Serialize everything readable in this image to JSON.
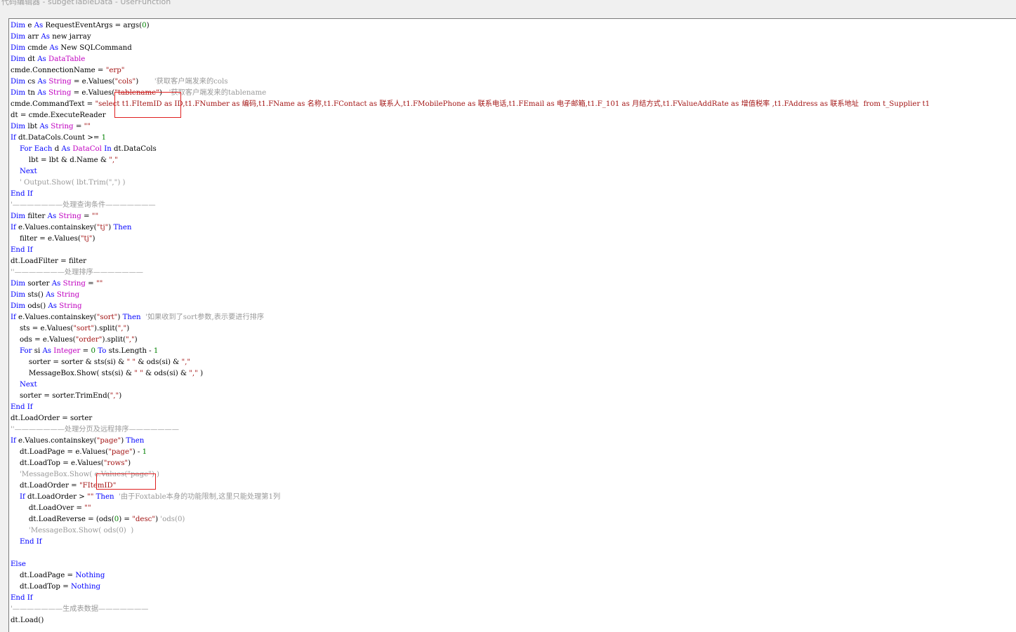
{
  "window": {
    "title": "代码编辑器 - subgetTableData - UserFunction"
  },
  "code_lines": [
    [
      [
        "kw",
        "Dim"
      ],
      [
        "t",
        " e "
      ],
      [
        "kw",
        "As"
      ],
      [
        "t",
        " RequestEventArgs = args("
      ],
      [
        "nm",
        "0"
      ],
      [
        "t",
        ")"
      ]
    ],
    [
      [
        "kw",
        "Dim"
      ],
      [
        "t",
        " arr "
      ],
      [
        "kw",
        "As"
      ],
      [
        "t",
        " new jarray"
      ]
    ],
    [
      [
        "kw",
        "Dim"
      ],
      [
        "t",
        " cmde "
      ],
      [
        "kw",
        "As"
      ],
      [
        "t",
        " New SQLCommand"
      ]
    ],
    [
      [
        "kw",
        "Dim"
      ],
      [
        "t",
        " dt "
      ],
      [
        "kw",
        "As"
      ],
      [
        "t",
        " "
      ],
      [
        "ty",
        "DataTable"
      ]
    ],
    [
      [
        "t",
        "cmde.ConnectionName = "
      ],
      [
        "st",
        "\"erp\""
      ]
    ],
    [
      [
        "kw",
        "Dim"
      ],
      [
        "t",
        " cs "
      ],
      [
        "kw",
        "As"
      ],
      [
        "t",
        " "
      ],
      [
        "ty",
        "String"
      ],
      [
        "t",
        " = e.Values("
      ],
      [
        "st",
        "\"cols\""
      ],
      [
        "t",
        ")       "
      ],
      [
        "cm",
        "'获取客户端发来的cols"
      ]
    ],
    [
      [
        "kw",
        "Dim"
      ],
      [
        "t",
        " tn "
      ],
      [
        "kw",
        "As"
      ],
      [
        "t",
        " "
      ],
      [
        "ty",
        "String"
      ],
      [
        "t",
        " = e.Values("
      ],
      [
        "st",
        "\"tablename\""
      ],
      [
        "t",
        ")   "
      ],
      [
        "cm",
        "'获取客户端发来的tablename"
      ]
    ],
    [
      [
        "t",
        "cmde.CommandText = "
      ],
      [
        "st",
        "\"select t1.FItemID as ID,t1.FNumber as 编码,t1.FName as 名称,t1.FContact as 联系人,t1.FMobilePhone as 联系电话,t1.FEmail as 电子邮箱,t1.F_101 as 月结方式,t1.FValueAddRate as 增值税率 ,t1.FAddress as 联系地址  from t_Supplier t1"
      ]
    ],
    [
      [
        "t",
        "dt = cmde.ExecuteReader"
      ]
    ],
    [
      [
        "kw",
        "Dim"
      ],
      [
        "t",
        " lbt "
      ],
      [
        "kw",
        "As"
      ],
      [
        "t",
        " "
      ],
      [
        "ty",
        "String"
      ],
      [
        "t",
        " = "
      ],
      [
        "st",
        "\"\""
      ]
    ],
    [
      [
        "kw",
        "If"
      ],
      [
        "t",
        " dt.DataCols.Count >= "
      ],
      [
        "nm",
        "1"
      ]
    ],
    [
      [
        "t",
        "    "
      ],
      [
        "kw",
        "For Each"
      ],
      [
        "t",
        " d "
      ],
      [
        "kw",
        "As"
      ],
      [
        "t",
        " "
      ],
      [
        "ty",
        "DataCol"
      ],
      [
        "t",
        " "
      ],
      [
        "kw",
        "In"
      ],
      [
        "t",
        " dt.DataCols"
      ]
    ],
    [
      [
        "t",
        "        lbt = lbt & d.Name & "
      ],
      [
        "st",
        "\",\""
      ]
    ],
    [
      [
        "t",
        "    "
      ],
      [
        "kw",
        "Next"
      ]
    ],
    [
      [
        "t",
        "    "
      ],
      [
        "cm",
        "' Output.Show( lbt.Trim(\",\") )"
      ]
    ],
    [
      [
        "kw",
        "End If"
      ]
    ],
    [
      [
        "cm",
        "'———————处理查询条件———————"
      ]
    ],
    [
      [
        "kw",
        "Dim"
      ],
      [
        "t",
        " filter "
      ],
      [
        "kw",
        "As"
      ],
      [
        "t",
        " "
      ],
      [
        "ty",
        "String"
      ],
      [
        "t",
        " = "
      ],
      [
        "st",
        "\"\""
      ]
    ],
    [
      [
        "kw",
        "If"
      ],
      [
        "t",
        " e.Values.containskey("
      ],
      [
        "st",
        "\"tj\""
      ],
      [
        "t",
        ") "
      ],
      [
        "kw",
        "Then"
      ]
    ],
    [
      [
        "t",
        "    filter = e.Values("
      ],
      [
        "st",
        "\"tj\""
      ],
      [
        "t",
        ")"
      ]
    ],
    [
      [
        "kw",
        "End If"
      ]
    ],
    [
      [
        "t",
        "dt.LoadFilter = filter"
      ]
    ],
    [
      [
        "cm",
        "''———————处理排序———————"
      ]
    ],
    [
      [
        "kw",
        "Dim"
      ],
      [
        "t",
        " sorter "
      ],
      [
        "kw",
        "As"
      ],
      [
        "t",
        " "
      ],
      [
        "ty",
        "String"
      ],
      [
        "t",
        " = "
      ],
      [
        "st",
        "\"\""
      ]
    ],
    [
      [
        "kw",
        "Dim"
      ],
      [
        "t",
        " sts() "
      ],
      [
        "kw",
        "As"
      ],
      [
        "t",
        " "
      ],
      [
        "ty",
        "String"
      ]
    ],
    [
      [
        "kw",
        "Dim"
      ],
      [
        "t",
        " ods() "
      ],
      [
        "kw",
        "As"
      ],
      [
        "t",
        " "
      ],
      [
        "ty",
        "String"
      ]
    ],
    [
      [
        "kw",
        "If"
      ],
      [
        "t",
        " e.Values.containskey("
      ],
      [
        "st",
        "\"sort\""
      ],
      [
        "t",
        ") "
      ],
      [
        "kw",
        "Then"
      ],
      [
        "t",
        "  "
      ],
      [
        "cm",
        "'如果收到了sort参数,表示要进行排序"
      ]
    ],
    [
      [
        "t",
        "    sts = e.Values("
      ],
      [
        "st",
        "\"sort\""
      ],
      [
        "t",
        ").split("
      ],
      [
        "st",
        "\",\""
      ],
      [
        "t",
        ")"
      ]
    ],
    [
      [
        "t",
        "    ods = e.Values("
      ],
      [
        "st",
        "\"order\""
      ],
      [
        "t",
        ").split("
      ],
      [
        "st",
        "\",\""
      ],
      [
        "t",
        ")"
      ]
    ],
    [
      [
        "t",
        "    "
      ],
      [
        "kw",
        "For"
      ],
      [
        "t",
        " si "
      ],
      [
        "kw",
        "As"
      ],
      [
        "t",
        " "
      ],
      [
        "ty",
        "Integer"
      ],
      [
        "t",
        " = "
      ],
      [
        "nm",
        "0"
      ],
      [
        "t",
        " "
      ],
      [
        "kw",
        "To"
      ],
      [
        "t",
        " sts.Length - "
      ],
      [
        "nm",
        "1"
      ]
    ],
    [
      [
        "t",
        "        sorter = sorter & sts(si) & "
      ],
      [
        "st",
        "\" \""
      ],
      [
        "t",
        " & ods(si) & "
      ],
      [
        "st",
        "\",\""
      ]
    ],
    [
      [
        "t",
        "        MessageBox.Show( sts(si) & "
      ],
      [
        "st",
        "\" \""
      ],
      [
        "t",
        " & ods(si) & "
      ],
      [
        "st",
        "\",\""
      ],
      [
        "t",
        " )"
      ]
    ],
    [
      [
        "t",
        "    "
      ],
      [
        "kw",
        "Next"
      ]
    ],
    [
      [
        "t",
        "    sorter = sorter.TrimEnd("
      ],
      [
        "st",
        "\",\""
      ],
      [
        "t",
        ")"
      ]
    ],
    [
      [
        "kw",
        "End If"
      ]
    ],
    [
      [
        "t",
        "dt.LoadOrder = sorter"
      ]
    ],
    [
      [
        "cm",
        "''———————处理分页及远程排序———————"
      ]
    ],
    [
      [
        "kw",
        "If"
      ],
      [
        "t",
        " e.Values.containskey("
      ],
      [
        "st",
        "\"page\""
      ],
      [
        "t",
        ") "
      ],
      [
        "kw",
        "Then"
      ]
    ],
    [
      [
        "t",
        "    dt.LoadPage = e.Values("
      ],
      [
        "st",
        "\"page\""
      ],
      [
        "t",
        ") - "
      ],
      [
        "nm",
        "1"
      ]
    ],
    [
      [
        "t",
        "    dt.LoadTop = e.Values("
      ],
      [
        "st",
        "\"rows\""
      ],
      [
        "t",
        ")"
      ]
    ],
    [
      [
        "t",
        "    "
      ],
      [
        "cm",
        "'MessageBox.Show( e.Values(\"page\") )"
      ]
    ],
    [
      [
        "t",
        "    dt.LoadOrder = "
      ],
      [
        "st",
        "\"FItemID\""
      ]
    ],
    [
      [
        "t",
        "    "
      ],
      [
        "kw",
        "If"
      ],
      [
        "t",
        " dt.LoadOrder > "
      ],
      [
        "st",
        "\"\""
      ],
      [
        "t",
        " "
      ],
      [
        "kw",
        "Then"
      ],
      [
        "t",
        "  "
      ],
      [
        "cm",
        "'由于Foxtable本身的功能限制,这里只能处理第1列"
      ]
    ],
    [
      [
        "t",
        "        dt.LoadOver = "
      ],
      [
        "st",
        "\"\""
      ]
    ],
    [
      [
        "t",
        "        dt.LoadReverse = (ods("
      ],
      [
        "nm",
        "0"
      ],
      [
        "t",
        ") = "
      ],
      [
        "st",
        "\"desc\""
      ],
      [
        "t",
        ") "
      ],
      [
        "cm",
        "'ods(0)"
      ]
    ],
    [
      [
        "t",
        "        "
      ],
      [
        "cm",
        "'MessageBox.Show( ods(0)  )"
      ]
    ],
    [
      [
        "t",
        "    "
      ],
      [
        "kw",
        "End If"
      ]
    ],
    [
      [
        "t",
        ""
      ]
    ],
    [
      [
        "kw",
        "Else"
      ]
    ],
    [
      [
        "t",
        "    dt.LoadPage = "
      ],
      [
        "kw",
        "Nothing"
      ]
    ],
    [
      [
        "t",
        "    dt.LoadTop = "
      ],
      [
        "kw",
        "Nothing"
      ]
    ],
    [
      [
        "kw",
        "End If"
      ]
    ],
    [
      [
        "cm",
        "'———————生成表数据———————"
      ]
    ],
    [
      [
        "t",
        "dt.Load()"
      ]
    ]
  ],
  "highlight_colors": {
    "keyword": "#0000ff",
    "type": "#c000c0",
    "string": "#a31515",
    "comment": "#999999",
    "number": "#008000",
    "annotation_box": "#e02020"
  }
}
